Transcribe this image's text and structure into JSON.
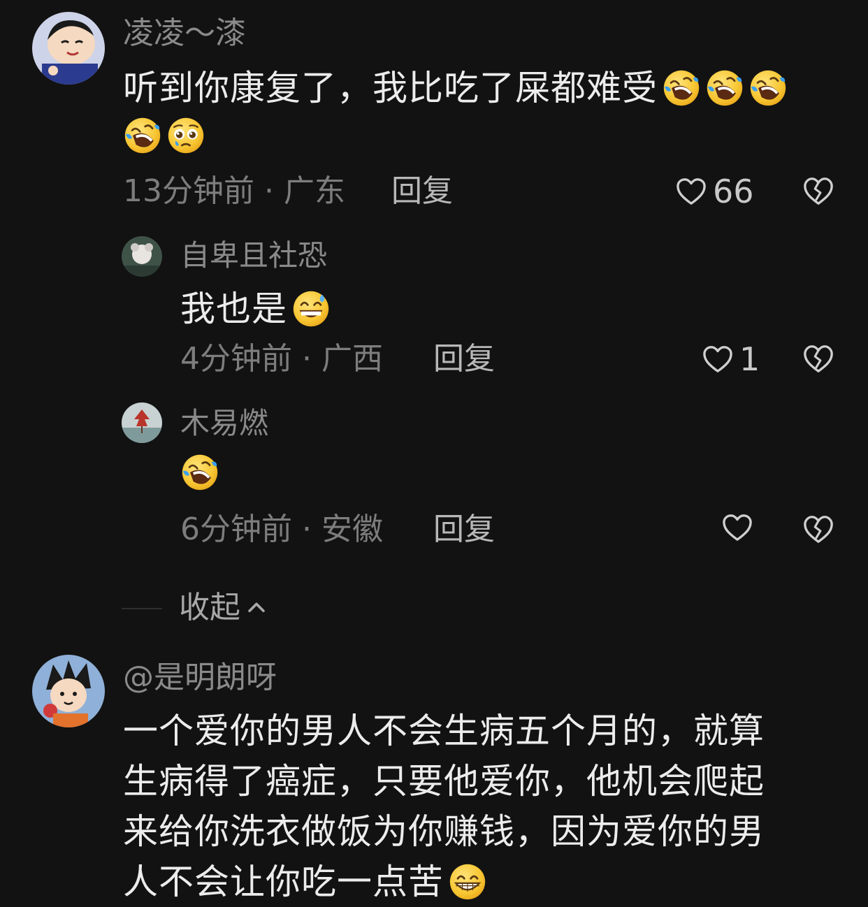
{
  "comments": [
    {
      "username": "凌凌～漆",
      "text": "听到你康复了，我比吃了屎都难受",
      "emojis": [
        "rofl-face-icon",
        "rofl-face-icon",
        "rofl-face-icon",
        "rofl-face-icon",
        "pleading-face-icon"
      ],
      "meta": "13分钟前 · 广东",
      "reply_label": "回复",
      "like_count": "66",
      "replies": [
        {
          "username": "自卑且社恐",
          "text": "我也是",
          "emojis": [
            "grin-sweat-face-icon"
          ],
          "meta": "4分钟前 · 广西",
          "reply_label": "回复",
          "like_count": "1"
        },
        {
          "username": "木易燃",
          "text": "",
          "emojis": [
            "rofl-face-icon"
          ],
          "meta": "6分钟前 · 安徽",
          "reply_label": "回复",
          "like_count": ""
        }
      ],
      "collapse_label": "收起"
    },
    {
      "username": "@是明朗呀",
      "text_lines": [
        "一个爱你的男人不会生病五个月的，就算",
        "生病得了癌症，只要他爱你，他机会爬起",
        "来给你洗衣做饭为你赚钱，因为爱你的男",
        "人不会让你吃一点苦"
      ],
      "emojis": [
        "beaming-face-icon"
      ]
    }
  ],
  "colors": {
    "background": "#121212",
    "username": "#8a8a8a",
    "content": "#ececec",
    "meta": "#7d7d7d",
    "emoji_yellow": "#f7c531"
  }
}
